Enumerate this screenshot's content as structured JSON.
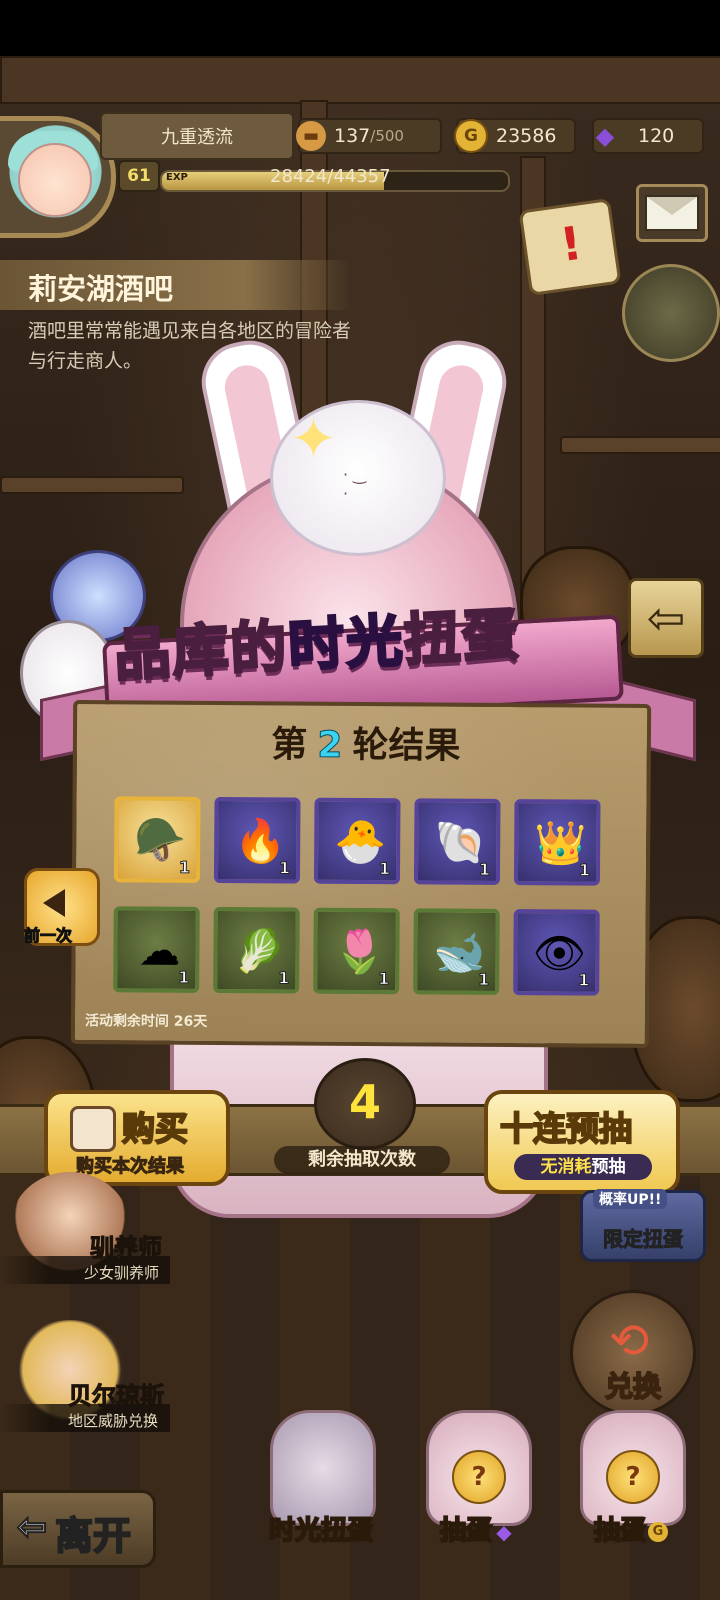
{
  "player": {
    "name": "九重透流",
    "level": "61",
    "exp_label": "EXP",
    "exp_text": "28424/44357",
    "exp_progress": 0.641
  },
  "resources": {
    "stamina_value": "137",
    "stamina_max": "/500",
    "gold": "23586",
    "gems": "120",
    "stamina_icon": "bread-icon",
    "gold_icon": "gold-coin-icon",
    "gem_icon": "purple-gem-icon"
  },
  "location": {
    "title": "莉安湖酒吧",
    "description": "酒吧里常常能遇见来自各地区的冒险者与行走商人。"
  },
  "banner": {
    "title_part1": "品库的",
    "title_highlight": "时光",
    "title_part2": "扭蛋"
  },
  "results": {
    "round_prefix": "第",
    "round_number": "2",
    "round_suffix": "轮结果",
    "items": [
      {
        "icon": "blue-helmet-icon",
        "glyph": "🪖",
        "count": "1",
        "rarity": "gold"
      },
      {
        "icon": "fire-swirl-icon",
        "glyph": "🔥",
        "count": "1",
        "rarity": "purple"
      },
      {
        "icon": "fluffy-chick-icon",
        "glyph": "🐣",
        "count": "1",
        "rarity": "purple"
      },
      {
        "icon": "crystal-shell-icon",
        "glyph": "🐚",
        "count": "1",
        "rarity": "purple"
      },
      {
        "icon": "flame-crown-icon",
        "glyph": "👑",
        "count": "1",
        "rarity": "purple"
      },
      {
        "icon": "grey-hair-icon",
        "glyph": "☁",
        "count": "1",
        "rarity": "green"
      },
      {
        "icon": "radish-icon",
        "glyph": "🥬",
        "count": "1",
        "rarity": "green"
      },
      {
        "icon": "purple-bud-icon",
        "glyph": "🌷",
        "count": "1",
        "rarity": "green"
      },
      {
        "icon": "sprout-whale-icon",
        "glyph": "🐋",
        "count": "1",
        "rarity": "green"
      },
      {
        "icon": "blue-eye-orb-icon",
        "glyph": "👁",
        "count": "1",
        "rarity": "purple"
      }
    ],
    "time_left": "活动剩余时间  26天"
  },
  "controls": {
    "prev_label": "前一次",
    "back_icon": "return-arrow-icon",
    "buy_title": "购买",
    "buy_subtitle": "购买本次结果",
    "remaining_count": "4",
    "remaining_label": "剩余抽取次数",
    "ten_title": "十连预抽",
    "ten_sub_highlight": "无消耗",
    "ten_sub_rest": "预抽",
    "limited_tag": "概率UP!!",
    "limited_label": "限定扭蛋"
  },
  "npcs": [
    {
      "name": "驯养师",
      "role": "少女驯养师"
    },
    {
      "name": "贝尔琼斯",
      "role": "地区威胁兑换"
    }
  ],
  "dock": {
    "exchange": "兑换",
    "leave": "离开",
    "time_gacha": "时光扭蛋",
    "gem_gacha": "抽蛋",
    "gold_gacha": "抽蛋",
    "gem_symbol": "◆",
    "gold_symbol": "G",
    "egg_mark": "?"
  }
}
